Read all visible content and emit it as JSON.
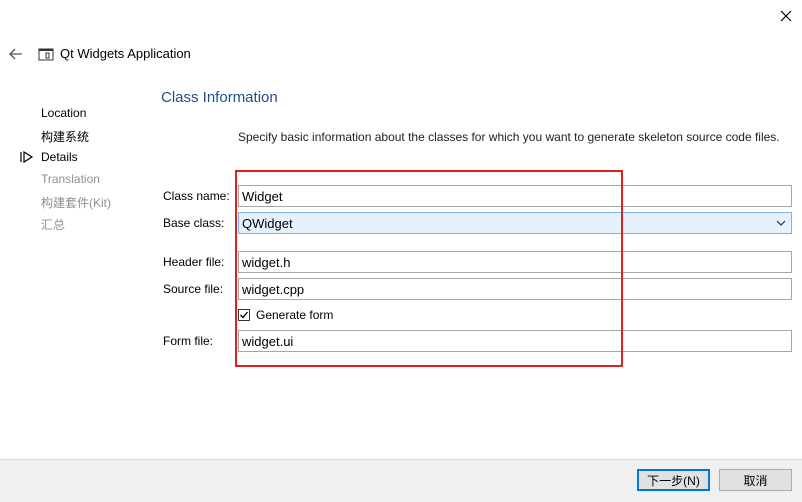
{
  "window": {
    "title": "Qt Widgets Application",
    "close_icon": "close-icon",
    "back_icon": "back-arrow-icon"
  },
  "steps": [
    {
      "label": "Location",
      "state": "done"
    },
    {
      "label": "构建系统",
      "state": "done"
    },
    {
      "label": "Details",
      "state": "current"
    },
    {
      "label": "Translation",
      "state": "pending"
    },
    {
      "label": "构建套件(Kit)",
      "state": "pending"
    },
    {
      "label": "汇总",
      "state": "pending"
    }
  ],
  "page": {
    "heading": "Class Information",
    "description": "Specify basic information about the classes for which you want to generate skeleton source code files."
  },
  "form": {
    "class_name": {
      "label": "Class name:",
      "value": "Widget"
    },
    "base_class": {
      "label": "Base class:",
      "value": "QWidget"
    },
    "header_file": {
      "label": "Header file:",
      "value": "widget.h"
    },
    "source_file": {
      "label": "Source file:",
      "value": "widget.cpp"
    },
    "generate_form": {
      "label": "Generate form",
      "checked": true
    },
    "form_file": {
      "label": "Form file:",
      "value": "widget.ui"
    }
  },
  "buttons": {
    "next": "下一步(N)",
    "cancel": "取消"
  },
  "colors": {
    "heading": "#1f4e8c",
    "highlight": "#e02020",
    "select_bg": "#e5f1fb",
    "default_button_border": "#0078d7"
  }
}
